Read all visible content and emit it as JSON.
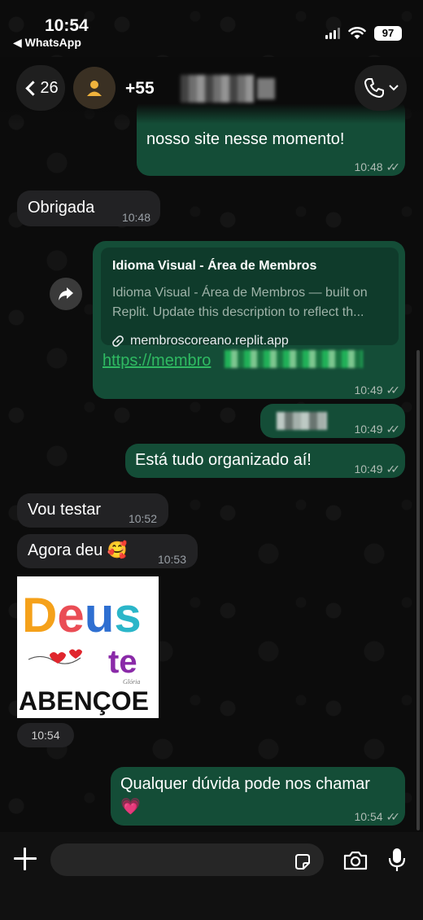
{
  "status_bar": {
    "time": "10:54",
    "back_app": "◀ WhatsApp",
    "battery": "97"
  },
  "header": {
    "unread_count": "26",
    "contact_name": "+55"
  },
  "messages": {
    "m1_text": "nosso site nesse momento!",
    "m1_time": "10:48",
    "m2_text": "Obrigada",
    "m2_time": "10:48",
    "link_title": "Idioma Visual - Área de Membros",
    "link_desc1": "Idioma Visual - Área de Membros — built on",
    "link_desc2": "Replit. Update this description to reflect th...",
    "link_domain": "membroscoreano.replit.app",
    "link_url": "https://membro",
    "m3_time": "10:49",
    "m4_time": "10:49",
    "m5_text": "Está tudo organizado aí!",
    "m5_time": "10:49",
    "m6_text": "Vou testar",
    "m6_time": "10:52",
    "m7_text": "Agora deu 🥰",
    "m7_time": "10:53",
    "sticker_word1": "Deus",
    "sticker_word2": "te",
    "sticker_word3": "ABENÇOE",
    "sticker_sign": "Glória",
    "sticker_time": "10:54",
    "m8_text": "Qualquer dúvida pode nos chamar",
    "m8_emoji": "💗",
    "m8_time": "10:54"
  },
  "input": {
    "placeholder": ""
  },
  "colors": {
    "outgoing_bubble": "#144d37",
    "incoming_bubble": "#222224",
    "link_green": "#2fba62"
  }
}
